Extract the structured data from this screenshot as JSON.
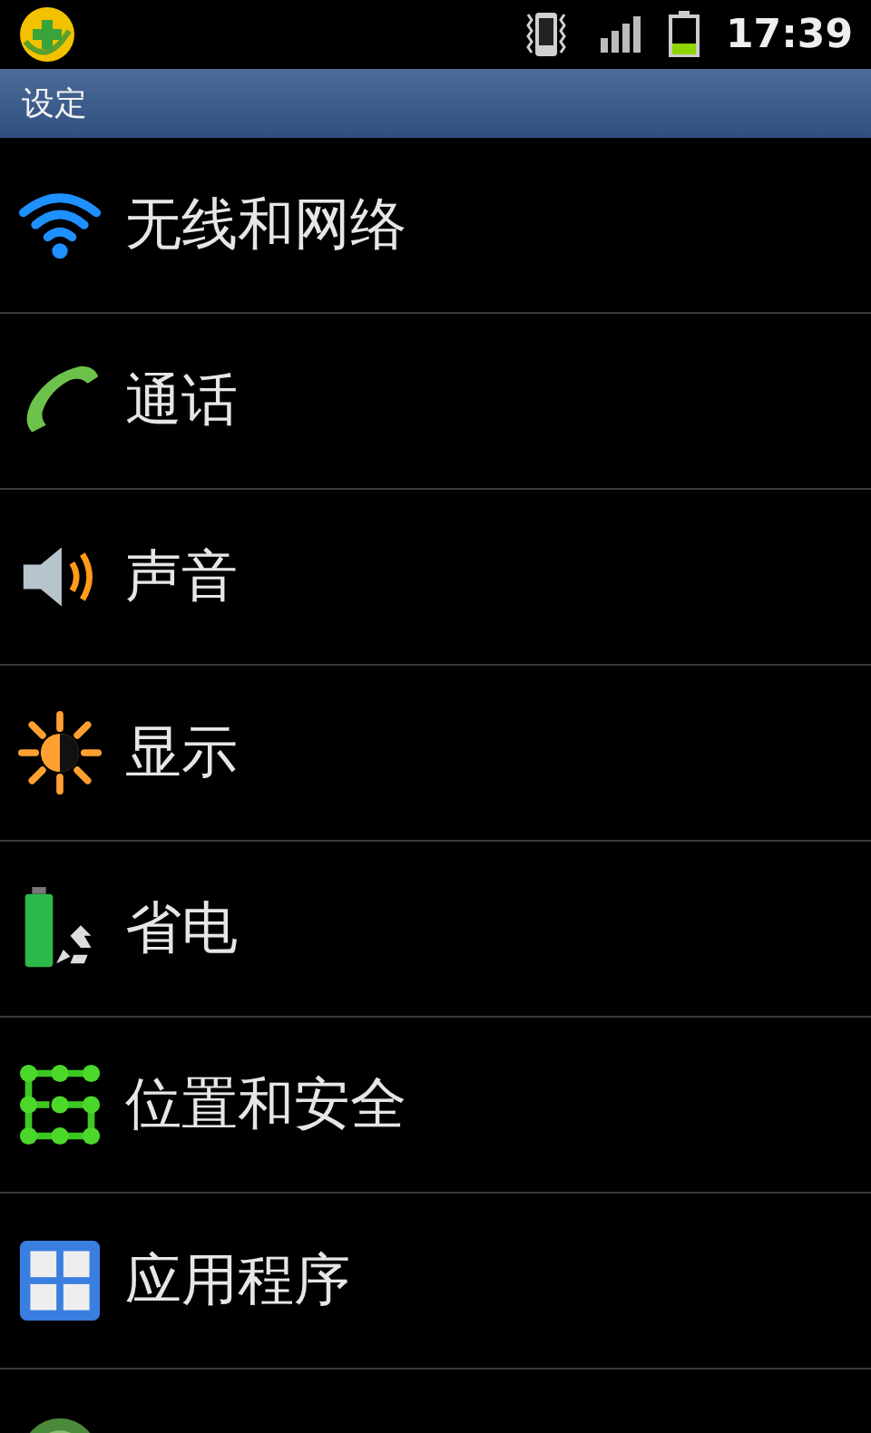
{
  "status_bar": {
    "time": "17:39"
  },
  "title_bar": {
    "title": "设定"
  },
  "items": [
    {
      "kind": "wifi",
      "label": "无线和网络"
    },
    {
      "kind": "call",
      "label": "通话"
    },
    {
      "kind": "sound",
      "label": "声音"
    },
    {
      "kind": "display",
      "label": "显示"
    },
    {
      "kind": "power",
      "label": "省电"
    },
    {
      "kind": "location",
      "label": "位置和安全"
    },
    {
      "kind": "apps",
      "label": "应用程序"
    },
    {
      "kind": "account"
    }
  ]
}
